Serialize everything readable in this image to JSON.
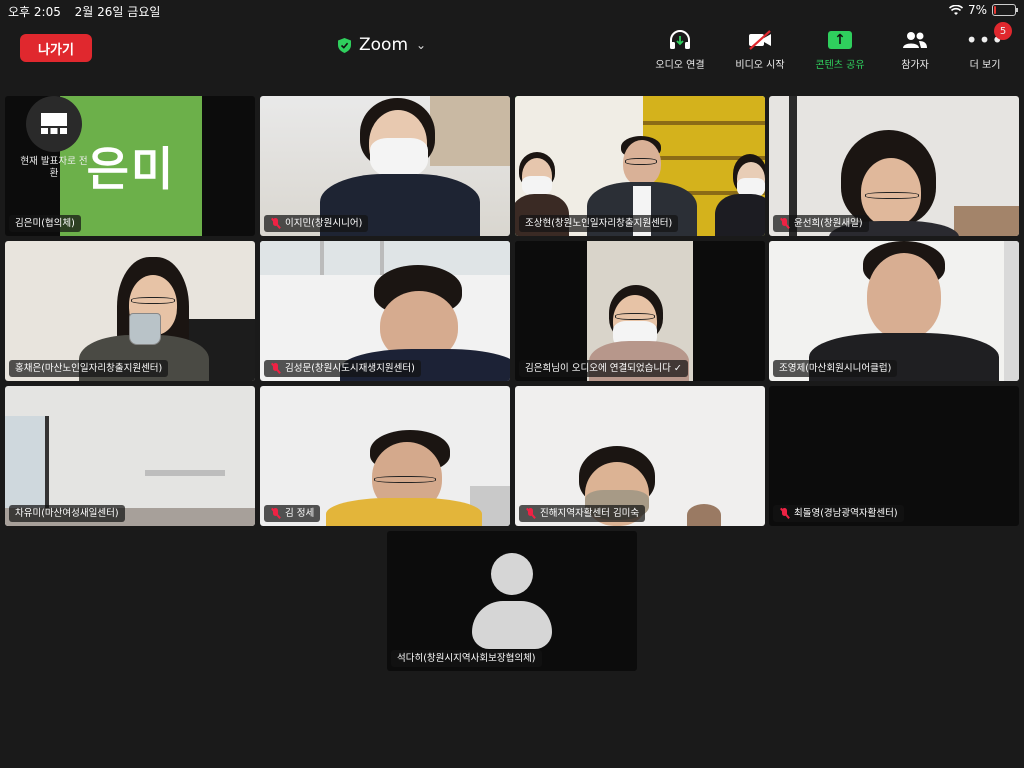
{
  "status_bar": {
    "time": "오후 2:05",
    "date": "2월 26일 금요일",
    "battery": "7%",
    "battery_level": 0.07
  },
  "toolbar": {
    "leave_label": "나가기",
    "title": "Zoom",
    "audio_label": "오디오 연결",
    "video_label": "비디오 시작",
    "share_label": "콘텐츠 공유",
    "participants_label": "참가자",
    "more_label": "더 보기",
    "more_badge": "5"
  },
  "presenter_switch_label": "현재 발표자로 전환",
  "tiles": [
    {
      "name": "김은미(협의체)",
      "muted": false,
      "board_text": "은미"
    },
    {
      "name": "이지민(창원시니어)",
      "muted": true
    },
    {
      "name": "조상현(창원노인일자리창출지원센터)",
      "muted": false,
      "active": true
    },
    {
      "name": "윤선희(창원새일)",
      "muted": true
    },
    {
      "name": "홍채은(마산노인일자리창출지원센터)",
      "muted": false
    },
    {
      "name": "김성문(창원시도시재생지원센터)",
      "muted": true
    },
    {
      "name": "김은희님이 오디오에 연결되었습니다 ✓",
      "muted": false
    },
    {
      "name": "조영제(마산회원시니어클럽)",
      "muted": false
    },
    {
      "name": "차유미(마산여성새일센터)",
      "muted": false
    },
    {
      "name": "김 정세",
      "muted": true
    },
    {
      "name": "진해지역자활센터 김미숙",
      "muted": true
    },
    {
      "name": "최돌영(경남광역자활센터)",
      "muted": true
    }
  ],
  "avatar_tile": {
    "name": "석다히(창원시지역사회보장협의체)"
  },
  "colors": {
    "leave": "#e0282e",
    "share": "#2fcf5d",
    "active_border": "#35d24e",
    "board": "#6cb04a"
  }
}
